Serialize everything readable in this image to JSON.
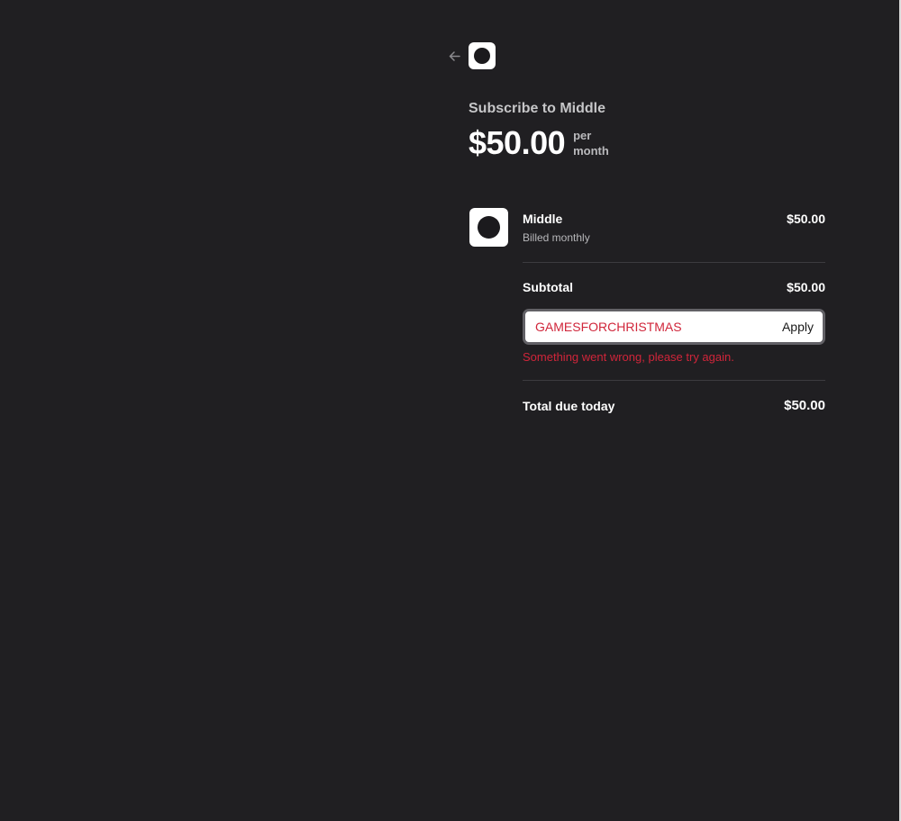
{
  "header": {
    "back_icon": "arrow-left-icon",
    "logo_icon": "circle-logo-icon"
  },
  "plan": {
    "subscribe_title": "Subscribe to Middle",
    "price": "$50.00",
    "period_line1": "per",
    "period_line2": "month"
  },
  "line_item": {
    "name": "Middle",
    "billing": "Billed monthly",
    "price": "$50.00"
  },
  "subtotal": {
    "label": "Subtotal",
    "value": "$50.00"
  },
  "promo": {
    "code": "GAMESFORCHRISTMAS",
    "apply_label": "Apply",
    "error": "Something went wrong, please try again."
  },
  "total": {
    "label": "Total due today",
    "value": "$50.00"
  },
  "colors": {
    "background": "#201f22",
    "error": "#d0253a",
    "text_primary": "#ffffff",
    "text_secondary": "#b7b7ba"
  }
}
